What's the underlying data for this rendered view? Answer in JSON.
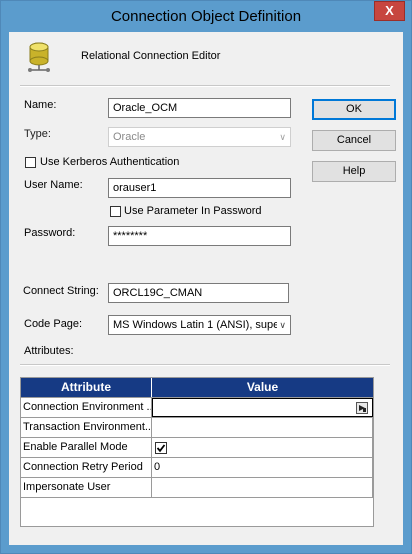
{
  "window": {
    "title": "Connection Object Definition",
    "close_glyph": "X"
  },
  "header": {
    "subtitle": "Relational Connection Editor"
  },
  "form": {
    "name_label": "Name:",
    "name_value": "Oracle_OCM",
    "type_label": "Type:",
    "type_value": "Oracle",
    "kerberos_label": "Use Kerberos Authentication",
    "username_label": "User Name:",
    "username_value": "orauser1",
    "param_password_label": "Use Parameter In Password",
    "password_label": "Password:",
    "password_value": "********",
    "connect_label": "Connect String:",
    "connect_value": "ORCL19C_CMAN",
    "codepage_label": "Code Page:",
    "codepage_value": "MS Windows Latin 1 (ANSI), supe",
    "attributes_label": "Attributes:"
  },
  "buttons": {
    "ok": "OK",
    "cancel": "Cancel",
    "help": "Help"
  },
  "table": {
    "headers": [
      "Attribute",
      "Value"
    ],
    "rows": [
      {
        "attribute": "Connection Environment ...",
        "value": ""
      },
      {
        "attribute": "Transaction Environment...",
        "value": ""
      },
      {
        "attribute": "Enable Parallel Mode",
        "value": ""
      },
      {
        "attribute": "Connection Retry Period",
        "value": "0"
      },
      {
        "attribute": "Impersonate User",
        "value": ""
      }
    ]
  },
  "colors": {
    "titlebar": "#5b9ccd",
    "table_header": "#163a84",
    "close_button": "#c7463f",
    "default_button_border": "#0078d7"
  },
  "icons": {
    "db": "database-icon",
    "checkmark": "checkmark-icon",
    "browse": "browse-icon"
  }
}
